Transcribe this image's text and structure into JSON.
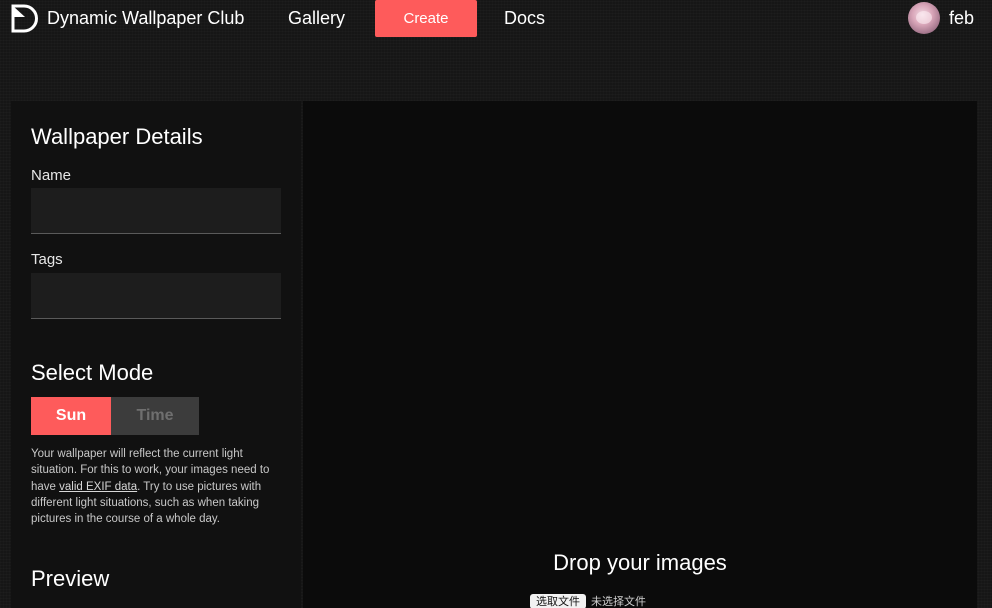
{
  "header": {
    "brand": "Dynamic Wallpaper Club",
    "nav": {
      "gallery": "Gallery",
      "create": "Create",
      "docs": "Docs"
    },
    "user": {
      "name": "feb"
    },
    "colors": {
      "accent": "#fe5b5b"
    }
  },
  "sidebar": {
    "details_title": "Wallpaper Details",
    "name_label": "Name",
    "name_value": "",
    "tags_label": "Tags",
    "tags_value": "",
    "mode_title": "Select Mode",
    "modes": {
      "sun": "Sun",
      "time": "Time",
      "selected": "Sun"
    },
    "mode_desc_before": "Your wallpaper will reflect the current light situation. For this to work, your images need to have ",
    "mode_desc_link": "valid EXIF data",
    "mode_desc_after": ". Try to use pictures with different light situations, such as when taking pictures in the course of a whole day.",
    "preview_title": "Preview"
  },
  "dropzone": {
    "title": "Drop your images",
    "file_button": "选取文件",
    "file_status": "未选择文件"
  },
  "icons": {
    "logo": "logo-icon",
    "avatar": "avatar"
  }
}
